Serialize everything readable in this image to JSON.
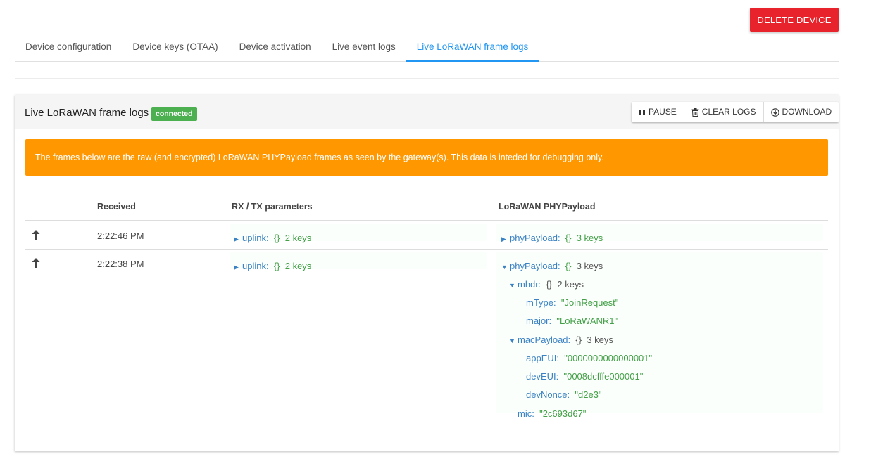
{
  "header": {
    "delete_label": "DELETE DEVICE"
  },
  "tabs": [
    {
      "label": "Device configuration",
      "active": false
    },
    {
      "label": "Device keys (OTAA)",
      "active": false
    },
    {
      "label": "Device activation",
      "active": false
    },
    {
      "label": "Live event logs",
      "active": false
    },
    {
      "label": "Live LoRaWAN frame logs",
      "active": true
    }
  ],
  "card": {
    "title": "Live LoRaWAN frame logs",
    "status_badge": "connected",
    "buttons": {
      "pause": "PAUSE",
      "clear": "CLEAR LOGS",
      "download": "DOWNLOAD"
    },
    "alert": "The frames below are the raw (and encrypted) LoRaWAN PHYPayload frames as seen by the gateway(s). This data is inteded for debugging only."
  },
  "table": {
    "columns": [
      "Received",
      "RX / TX parameters",
      "LoRaWAN PHYPayload"
    ],
    "rows": [
      {
        "direction_icon": "arrow-up-icon",
        "received": "2:22:46 PM",
        "rxtx": {
          "key": "uplink:",
          "brace": "{}",
          "count": "2 keys"
        },
        "phy": {
          "key": "phyPayload:",
          "brace": "{}",
          "count": "3 keys"
        }
      },
      {
        "direction_icon": "arrow-up-icon",
        "received": "2:22:38 PM",
        "rxtx": {
          "key": "uplink:",
          "brace": "{}",
          "count": "2 keys"
        },
        "phy": {
          "key": "phyPayload:",
          "brace": "{}",
          "count": "3 keys",
          "mhdr": {
            "key": "mhdr:",
            "brace": "{}",
            "count": "2 keys",
            "mType_key": "mType:",
            "mType": "\"JoinRequest\"",
            "major_key": "major:",
            "major": "\"LoRaWANR1\""
          },
          "macPayload": {
            "key": "macPayload:",
            "brace": "{}",
            "count": "3 keys",
            "appEUI_key": "appEUI:",
            "appEUI": "\"0000000000000001\"",
            "devEUI_key": "devEUI:",
            "devEUI": "\"0008dcfffe000001\"",
            "devNonce_key": "devNonce:",
            "devNonce": "\"d2e3\""
          },
          "mic_key": "mic:",
          "mic": "\"2c693d67\""
        }
      }
    ]
  },
  "colors": {
    "accent": "#2196f3",
    "danger": "#e8232b",
    "warning": "#ff9800",
    "success": "#4caf50"
  }
}
